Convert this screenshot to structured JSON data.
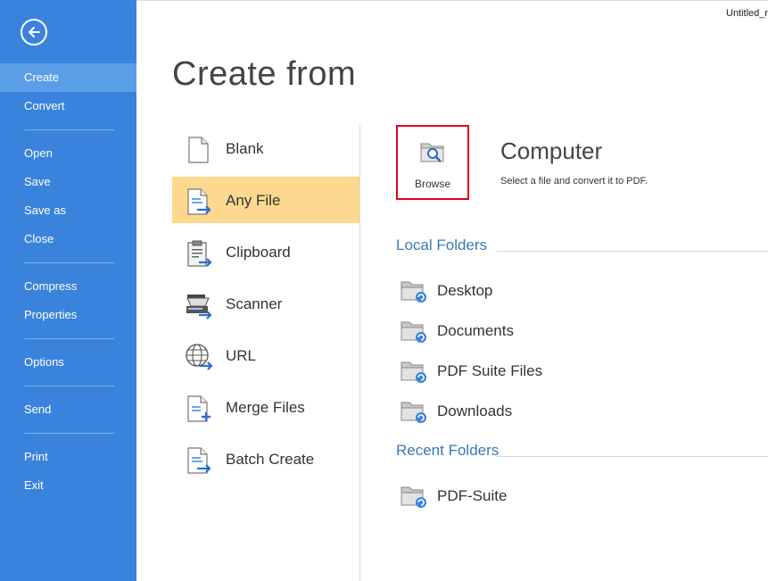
{
  "window": {
    "doc_title": "Untitled_r"
  },
  "sidebar": {
    "items": [
      {
        "label": "Create"
      },
      {
        "label": "Convert"
      },
      {
        "label": "Open"
      },
      {
        "label": "Save"
      },
      {
        "label": "Save as"
      },
      {
        "label": "Close"
      },
      {
        "label": "Compress"
      },
      {
        "label": "Properties"
      },
      {
        "label": "Options"
      },
      {
        "label": "Send"
      },
      {
        "label": "Print"
      },
      {
        "label": "Exit"
      }
    ]
  },
  "main": {
    "title": "Create from",
    "sources": [
      {
        "label": "Blank"
      },
      {
        "label": "Any File"
      },
      {
        "label": "Clipboard"
      },
      {
        "label": "Scanner"
      },
      {
        "label": "URL"
      },
      {
        "label": "Merge Files"
      },
      {
        "label": "Batch Create"
      }
    ]
  },
  "panel": {
    "browse_label": "Browse",
    "computer_title": "Computer",
    "computer_desc": "Select a file and convert it to PDF.",
    "local_title": "Local Folders",
    "local_folders": [
      {
        "label": "Desktop"
      },
      {
        "label": "Documents"
      },
      {
        "label": "PDF Suite Files"
      },
      {
        "label": "Downloads"
      }
    ],
    "recent_title": "Recent Folders",
    "recent_folders": [
      {
        "label": "PDF-Suite"
      }
    ]
  },
  "colors": {
    "sidebar": "#3a83dc",
    "sidebar_active": "#5b9ee8",
    "selected": "#fdd98f",
    "highlight_border": "#e3001b",
    "section_title": "#3b78b5"
  }
}
